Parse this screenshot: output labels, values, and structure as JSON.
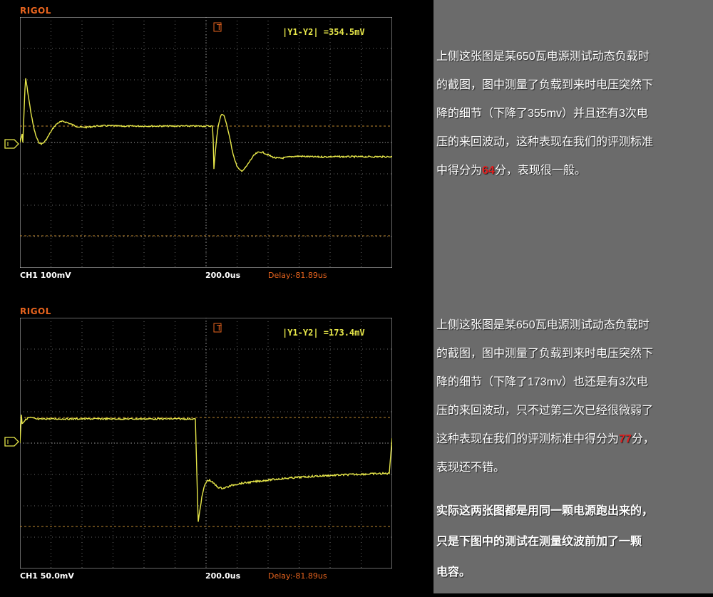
{
  "scopes": [
    {
      "brand": "RIGOL",
      "measurement": "|Y1-Y2| =354.5mV",
      "channel": "CH1 100mV",
      "timebase": "200.0us",
      "delay": "Delay:-81.89us",
      "trace_color": "#e8e84a"
    },
    {
      "brand": "RIGOL",
      "measurement": "|Y1-Y2| =173.4mV",
      "channel": "CH1 50.0mV",
      "timebase": "200.0us",
      "delay": "Delay:-81.89us",
      "trace_color": "#e8e84a"
    }
  ],
  "notes": [
    {
      "lines": [
        "上侧这张图是某650瓦电源测试动态负载时",
        "的截图，图中测量了负载到来时电压突然下",
        "降的细节（下降了355mv）并且还有3次电",
        "压的来回波动，这种表现在我们的评测标准"
      ],
      "last_before": "中得分为",
      "score": "64",
      "last_after": "分，表现很一般。"
    },
    {
      "lines": [
        "上侧这张图是某650瓦电源测试动态负载时",
        "的截图，图中测量了负载到来时电压突然下",
        "降的细节（下降了173mv）也还是有3次电",
        "压的来回波动，只不过第三次已经很微弱了"
      ],
      "last_before": "这种表现在我们的评测标准中得分为",
      "score": "77",
      "last_after": "分，",
      "tail": "表现还不错。"
    }
  ],
  "conclusion": [
    "实际这两张图都是用同一颗电源跑出来的，",
    "只是下图中的测试在测量纹波前加了一颗",
    "电容。"
  ],
  "colors": {
    "brand": "#e8641e",
    "trace": "#e8e84a",
    "highlight": "#e02020",
    "panel": "#6b6b6b"
  }
}
